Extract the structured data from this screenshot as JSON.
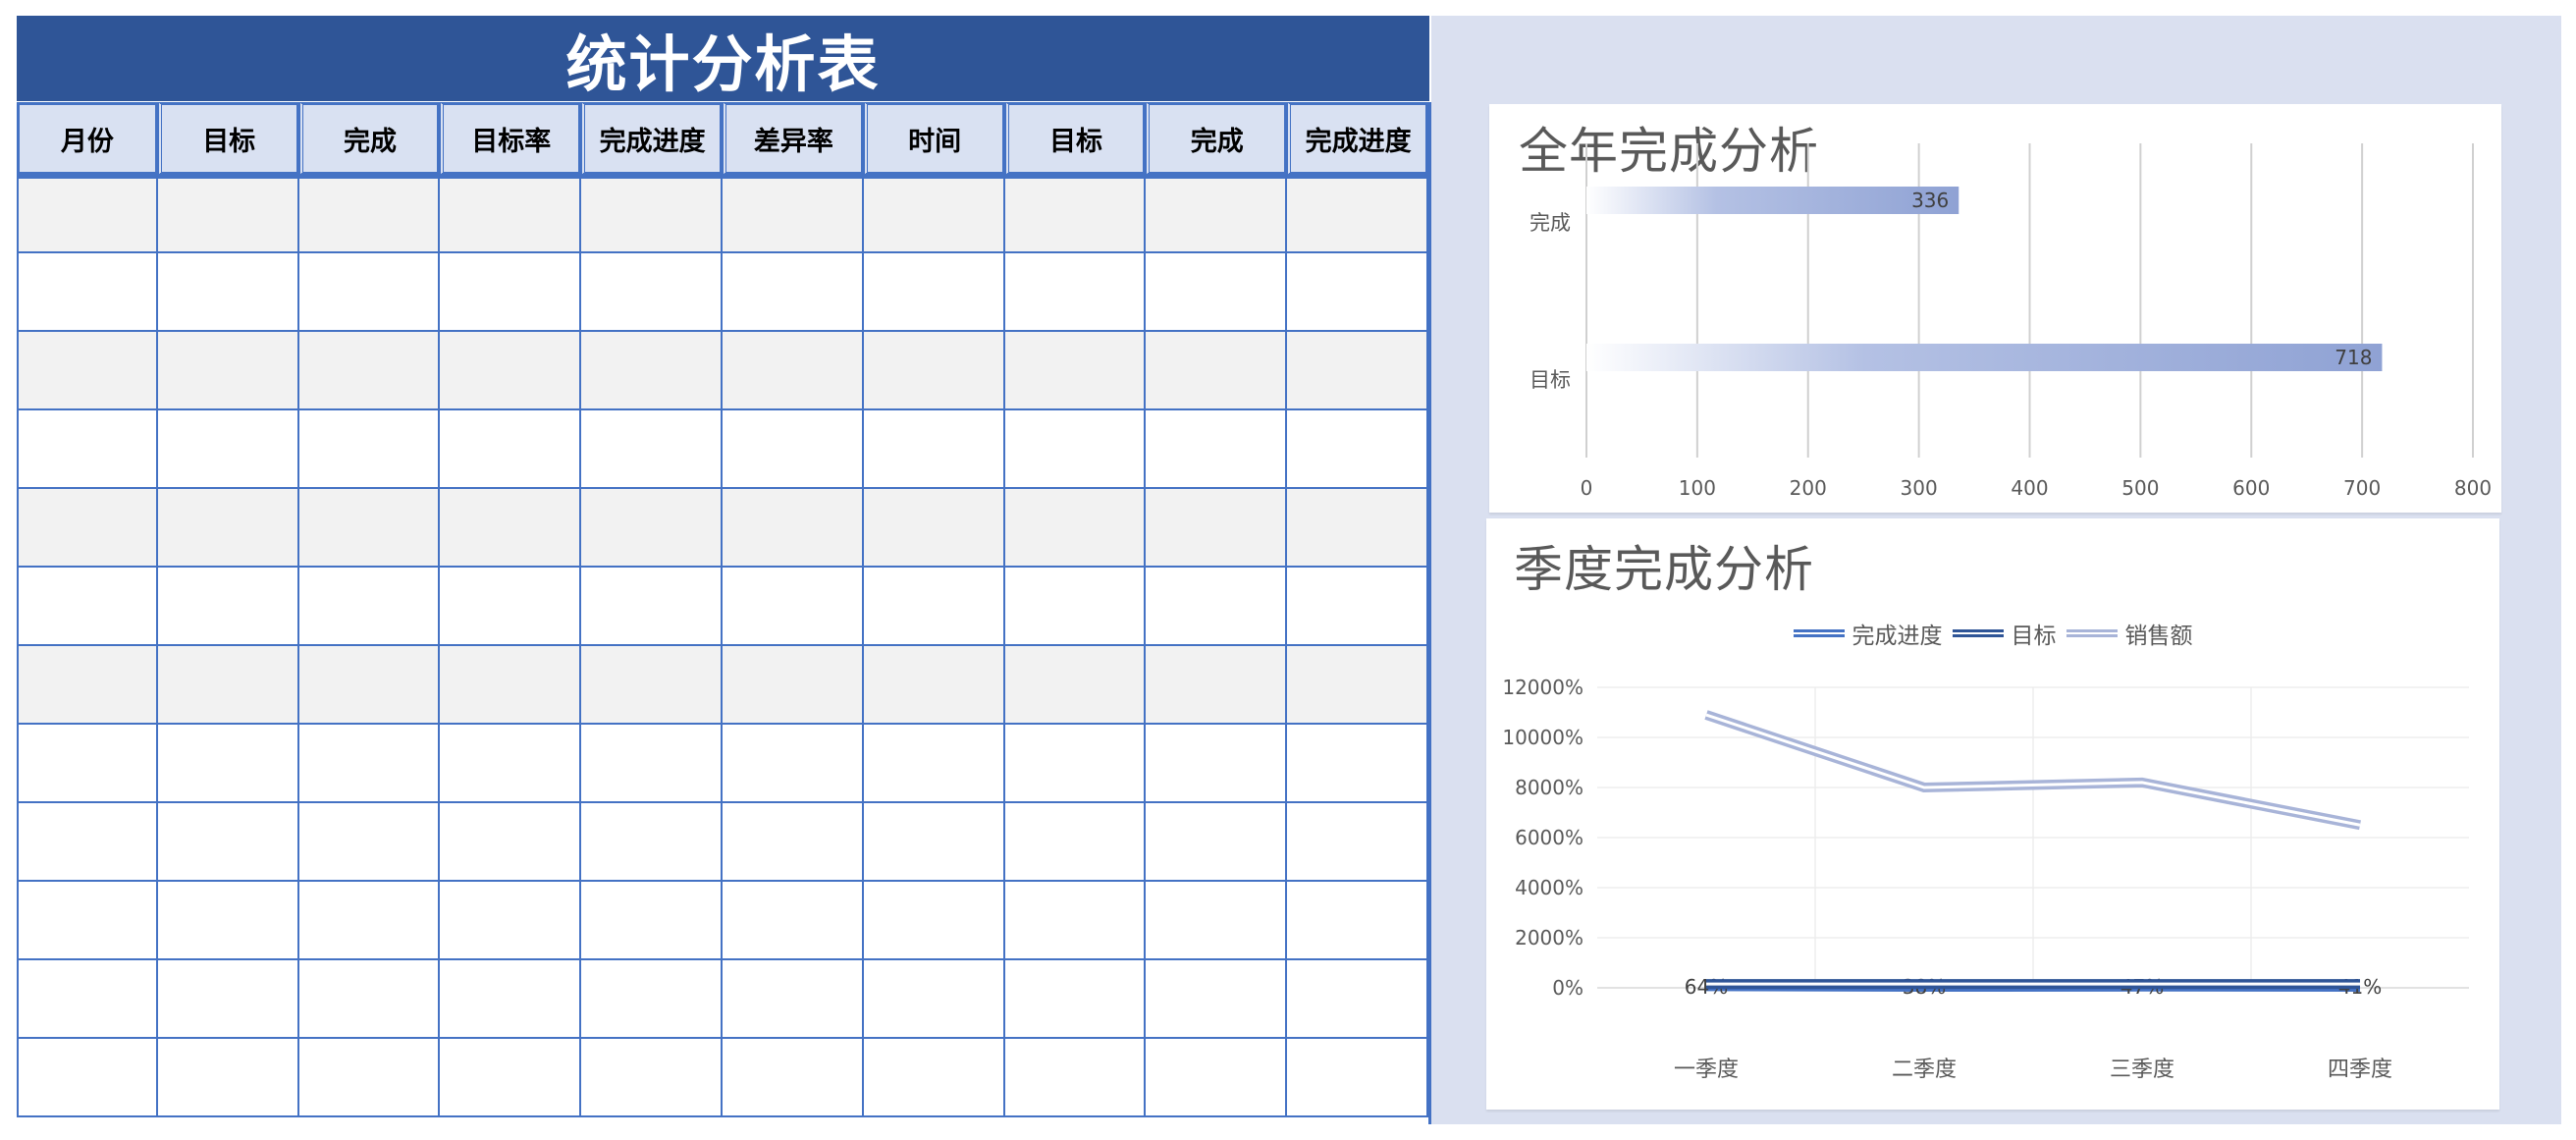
{
  "sheet": {
    "title": "统计分析表",
    "columns": [
      "月份",
      "目标",
      "完成",
      "目标率",
      "完成进度",
      "差异率",
      "时间",
      "目标",
      "完成",
      "完成进度"
    ],
    "rows": [
      [
        "",
        "",
        "",
        "",
        "",
        "",
        "",
        "",
        "",
        ""
      ],
      [
        "",
        "",
        "",
        "",
        "",
        "",
        "",
        "",
        "",
        ""
      ],
      [
        "",
        "",
        "",
        "",
        "",
        "",
        "",
        "",
        "",
        ""
      ],
      [
        "",
        "",
        "",
        "",
        "",
        "",
        "",
        "",
        "",
        ""
      ],
      [
        "",
        "",
        "",
        "",
        "",
        "",
        "",
        "",
        "",
        ""
      ],
      [
        "",
        "",
        "",
        "",
        "",
        "",
        "",
        "",
        "",
        ""
      ],
      [
        "",
        "",
        "",
        "",
        "",
        "",
        "",
        "",
        "",
        ""
      ],
      [
        "",
        "",
        "",
        "",
        "",
        "",
        "",
        "",
        "",
        ""
      ],
      [
        "",
        "",
        "",
        "",
        "",
        "",
        "",
        "",
        "",
        ""
      ],
      [
        "",
        "",
        "",
        "",
        "",
        "",
        "",
        "",
        "",
        ""
      ],
      [
        "",
        "",
        "",
        "",
        "",
        "",
        "",
        "",
        "",
        ""
      ],
      [
        "",
        "",
        "",
        "",
        "",
        "",
        "",
        "",
        "",
        ""
      ]
    ]
  },
  "colors": {
    "banner": "#2F5597",
    "header_fill": "#D9E1F2",
    "grid_border": "#4472C4",
    "shaded_row": "#F2F2F2",
    "panel": "#DAE0F0",
    "bar_gradient_end": "#8FA2D4",
    "line_progress": "#4472C4",
    "line_target": "#2F5597",
    "line_sales": "#A8B4D8"
  },
  "chart_data": [
    {
      "type": "bar",
      "orientation": "horizontal",
      "title": "全年完成分析",
      "categories": [
        "完成",
        "目标"
      ],
      "values": [
        336,
        718
      ],
      "data_labels": [
        "336",
        "718"
      ],
      "xlim": [
        0,
        800
      ],
      "x_ticks": [
        "0",
        "100",
        "200",
        "300",
        "400",
        "500",
        "600",
        "700",
        "800"
      ],
      "grid": "vertical",
      "legend": "none"
    },
    {
      "type": "line",
      "title": "季度完成分析",
      "categories": [
        "一季度",
        "二季度",
        "三季度",
        "四季度"
      ],
      "series": [
        {
          "name": "完成进度",
          "values": [
            0.64,
            0.38,
            0.47,
            0.41
          ],
          "labels": [
            "64%",
            "38%",
            "47%",
            "41%"
          ]
        },
        {
          "name": "目标",
          "values": [
            1.5,
            1.5,
            1.5,
            1.5
          ]
        },
        {
          "name": "销售额",
          "values": [
            109,
            80,
            82,
            65
          ]
        }
      ],
      "ylim_percent": [
        0,
        12000
      ],
      "y_ticks": [
        "0%",
        "2000%",
        "4000%",
        "6000%",
        "8000%",
        "10000%",
        "12000%"
      ],
      "grid": "both",
      "legend": "top"
    }
  ]
}
